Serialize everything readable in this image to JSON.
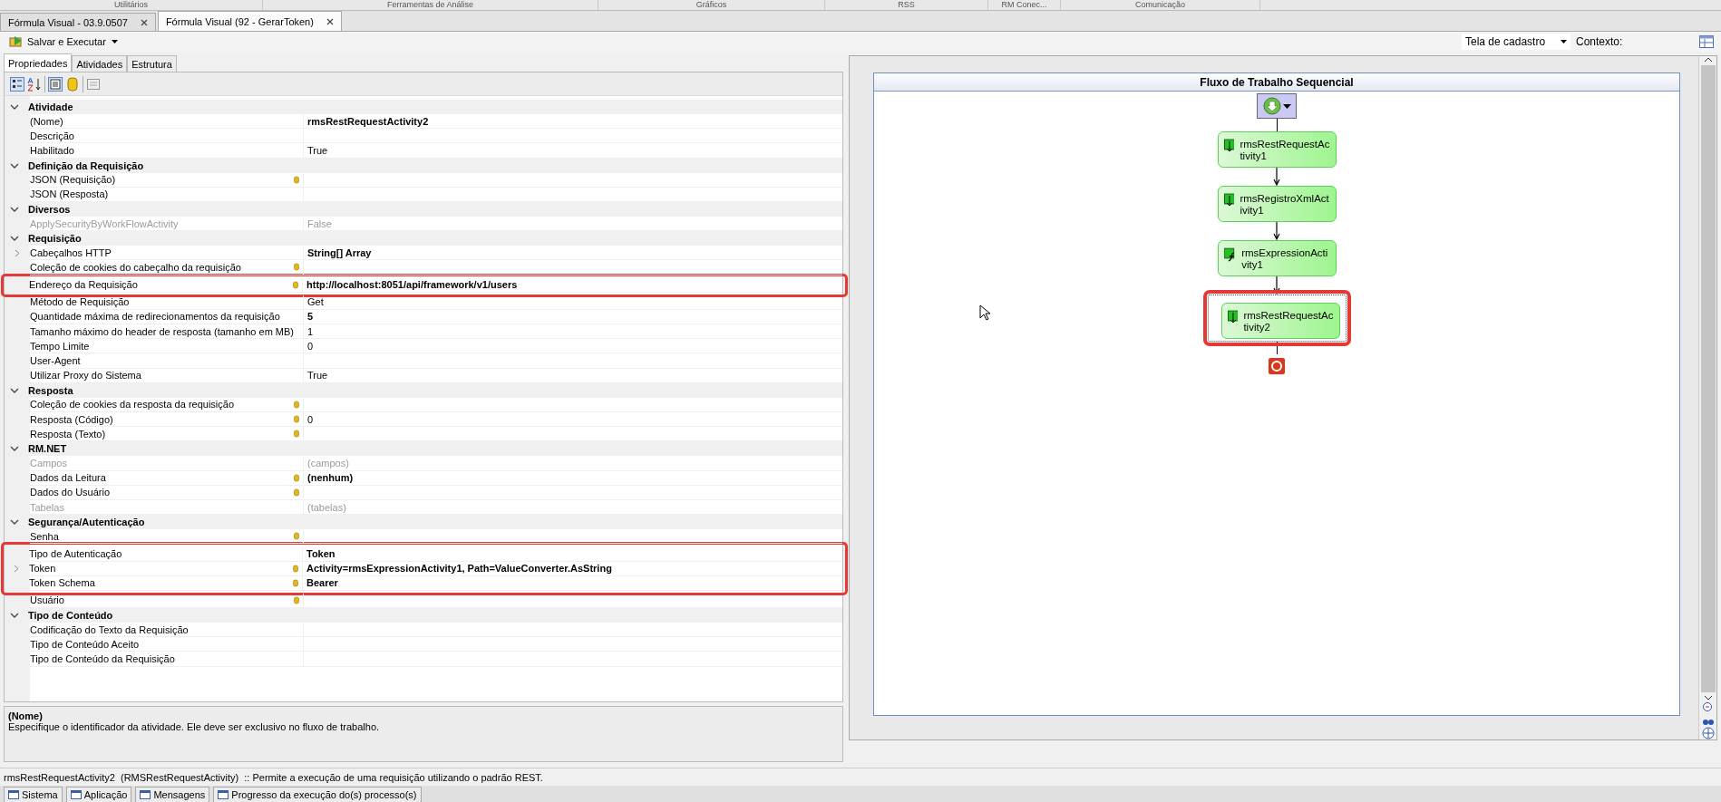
{
  "ribbon_tabs": [
    "Utilitários",
    "Ferramentas de Análise",
    "Gráficos",
    "RSS",
    "RM Conec...",
    "Comunicação"
  ],
  "document_tabs": [
    {
      "label": "Fórmula Visual - 03.9.0507",
      "selected": false
    },
    {
      "label": "Fórmula Visual (92 - GerarToken)",
      "selected": true
    }
  ],
  "toolbar": {
    "run_button": "Salvar e Executar",
    "view_select": "Tela de cadastro",
    "context_label": "Contexto:"
  },
  "panel_tabs": [
    {
      "label": "Propriedades",
      "selected": true
    },
    {
      "label": "Atividades",
      "selected": false
    },
    {
      "label": "Estrutura",
      "selected": false
    }
  ],
  "property_grid": {
    "categories": [
      {
        "name": "Atividade",
        "expanded": true,
        "rows": [
          {
            "label": "(Nome)",
            "value": "rmsRestRequestActivity2",
            "bold": true,
            "disabled": false,
            "bound": false,
            "expandable": false,
            "highlighted": false
          },
          {
            "label": "Descrição",
            "disabled": false,
            "bound": false,
            "expandable": false,
            "highlighted": false
          },
          {
            "label": "Habilitado",
            "value": "True",
            "bold": false,
            "disabled": false,
            "bound": false,
            "expandable": false,
            "highlighted": false
          }
        ]
      },
      {
        "name": "Definição da Requisição",
        "expanded": true,
        "rows": [
          {
            "label": "JSON (Requisição)",
            "disabled": false,
            "bound": true,
            "expandable": false,
            "highlighted": false
          },
          {
            "label": "JSON (Resposta)",
            "disabled": false,
            "bound": false,
            "expandable": false,
            "highlighted": false
          }
        ]
      },
      {
        "name": "Diversos",
        "expanded": true,
        "rows": [
          {
            "label": "ApplySecurityByWorkFlowActivity",
            "value": "False",
            "bold": false,
            "disabled": true,
            "bound": false,
            "expandable": false,
            "highlighted": false
          }
        ]
      },
      {
        "name": "Requisição",
        "expanded": true,
        "rows": [
          {
            "label": "Cabeçalhos HTTP",
            "value": "String[] Array",
            "bold": true,
            "disabled": false,
            "bound": false,
            "expandable": true,
            "highlighted": false
          },
          {
            "label": "Coleção de cookies do cabeçalho da requisição",
            "disabled": false,
            "bound": true,
            "expandable": false,
            "highlighted": false
          },
          {
            "label": "Endereço da Requisição",
            "value": "http://localhost:8051/api/framework/v1/users",
            "bold": true,
            "disabled": false,
            "bound": true,
            "expandable": false,
            "highlighted": true
          },
          {
            "label": "Método de Requisição",
            "value": "Get",
            "bold": false,
            "disabled": false,
            "bound": false,
            "expandable": false,
            "highlighted": false
          },
          {
            "label": "Quantidade máxima de redirecionamentos da requisição",
            "value": "5",
            "bold": true,
            "disabled": false,
            "bound": false,
            "expandable": false,
            "highlighted": false
          },
          {
            "label": "Tamanho máximo do header de resposta (tamanho em MB)",
            "value": "1",
            "bold": false,
            "disabled": false,
            "bound": false,
            "expandable": false,
            "highlighted": false
          },
          {
            "label": "Tempo Limite",
            "value": "0",
            "bold": false,
            "disabled": false,
            "bound": false,
            "expandable": false,
            "highlighted": false
          },
          {
            "label": "User-Agent",
            "disabled": false,
            "bound": false,
            "expandable": false,
            "highlighted": false
          },
          {
            "label": "Utilizar Proxy do Sistema",
            "value": "True",
            "bold": false,
            "disabled": false,
            "bound": false,
            "expandable": false,
            "highlighted": false
          }
        ]
      },
      {
        "name": "Resposta",
        "expanded": true,
        "rows": [
          {
            "label": "Coleção de cookies da resposta da requisição",
            "disabled": false,
            "bound": true,
            "expandable": false,
            "highlighted": false
          },
          {
            "label": "Resposta (Código)",
            "value": "0",
            "bold": false,
            "disabled": false,
            "bound": true,
            "expandable": false,
            "highlighted": false
          },
          {
            "label": "Resposta (Texto)",
            "disabled": false,
            "bound": true,
            "expandable": false,
            "highlighted": false
          }
        ]
      },
      {
        "name": "RM.NET",
        "expanded": true,
        "rows": [
          {
            "label": "Campos",
            "value": "(campos)",
            "bold": false,
            "disabled": true,
            "bound": false,
            "expandable": false,
            "highlighted": false
          },
          {
            "label": "Dados da Leitura",
            "value": "(nenhum)",
            "bold": true,
            "disabled": false,
            "bound": true,
            "expandable": false,
            "highlighted": false
          },
          {
            "label": "Dados do Usuário",
            "disabled": false,
            "bound": true,
            "expandable": false,
            "highlighted": false
          },
          {
            "label": "Tabelas",
            "value": "(tabelas)",
            "bold": false,
            "disabled": true,
            "bound": false,
            "expandable": false,
            "highlighted": false
          }
        ]
      },
      {
        "name": "Segurança/Autenticação",
        "expanded": true,
        "rows": [
          {
            "label": "Senha",
            "disabled": false,
            "bound": true,
            "expandable": false,
            "highlighted": false
          },
          {
            "label": "Tipo de Autenticação",
            "value": "Token",
            "bold": true,
            "disabled": false,
            "bound": false,
            "expandable": false,
            "highlighted": true
          },
          {
            "label": "Token",
            "value": "Activity=rmsExpressionActivity1, Path=ValueConverter.AsString",
            "bold": true,
            "disabled": false,
            "bound": true,
            "expandable": true,
            "highlighted": true
          },
          {
            "label": "Token Schema",
            "value": "Bearer",
            "bold": true,
            "disabled": false,
            "bound": true,
            "expandable": false,
            "highlighted": true
          },
          {
            "label": "Usuário",
            "disabled": false,
            "bound": true,
            "expandable": false,
            "highlighted": false
          }
        ]
      },
      {
        "name": "Tipo de Conteúdo",
        "expanded": true,
        "rows": [
          {
            "label": "Codificação do Texto da Requisição",
            "disabled": false,
            "bound": false,
            "expandable": false,
            "highlighted": false
          },
          {
            "label": "Tipo de Conteúdo Aceito",
            "disabled": false,
            "bound": false,
            "expandable": false,
            "highlighted": false
          },
          {
            "label": "Tipo de Conteúdo da Requisição",
            "disabled": false,
            "bound": false,
            "expandable": false,
            "highlighted": false
          }
        ]
      }
    ]
  },
  "description": {
    "title": "(Nome)",
    "text": "Especifique o identificador da atividade. Ele deve ser exclusivo no fluxo de trabalho."
  },
  "workflow": {
    "title": "Fluxo de Trabalho Sequencial",
    "activities": [
      {
        "name": "rmsRestRequestAc tivity1",
        "kind": "request",
        "selected": false,
        "highlighted": false
      },
      {
        "name": "rmsRegistroXmlAct ivity1",
        "kind": "request",
        "selected": false,
        "highlighted": false
      },
      {
        "name": "rmsExpressionActi vity1",
        "kind": "expression",
        "selected": false,
        "highlighted": false
      },
      {
        "name": "rmsRestRequestAc tivity2",
        "kind": "request",
        "selected": true,
        "highlighted": true
      }
    ]
  },
  "status_bar": "rmsRestRequestActivity2  (RMSRestRequestActivity)  :: Permite a execução de uma requisição utilizando o padrão REST.",
  "bottom_tabs": [
    "Sistema",
    "Aplicação",
    "Mensagens",
    "Progresso da execução do(s) processo(s)"
  ]
}
